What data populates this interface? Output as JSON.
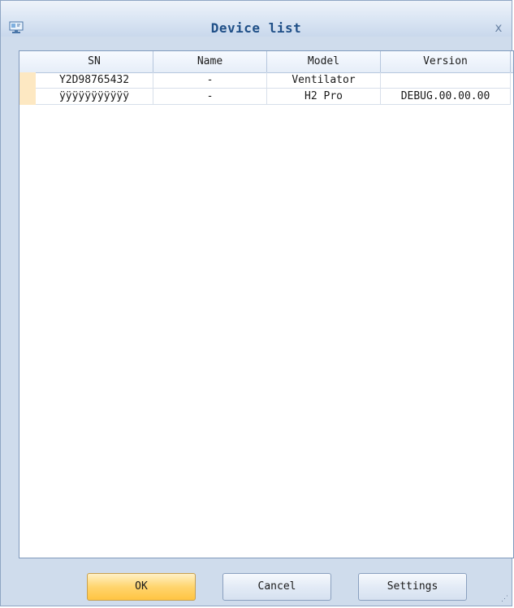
{
  "window": {
    "title": "Device list",
    "close_label": "x"
  },
  "table": {
    "columns": [
      "SN",
      "Name",
      "Model",
      "Version"
    ],
    "rows": [
      {
        "sn": "Y2D98765432",
        "name": "-",
        "model": "Ventilator",
        "version": ""
      },
      {
        "sn": "ÿÿÿÿÿÿÿÿÿÿÿ",
        "name": "-",
        "model": "H2 Pro",
        "version": "DEBUG.00.00.00"
      }
    ]
  },
  "buttons": {
    "ok": "OK",
    "cancel": "Cancel",
    "settings": "Settings"
  },
  "colors": {
    "title_text": "#1f4f87",
    "row_marker": "#fde8c2",
    "ok_button": "#ffd56e"
  }
}
